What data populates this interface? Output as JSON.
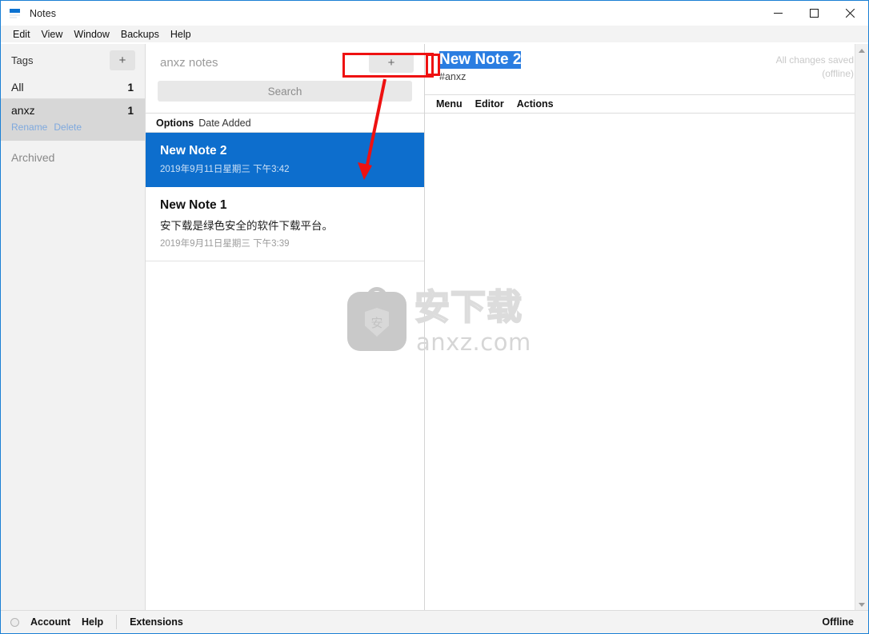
{
  "window": {
    "title": "Notes",
    "icon": "notes-app-icon",
    "controls": {
      "minimize": "minimize-icon",
      "maximize": "maximize-icon",
      "close": "close-icon"
    }
  },
  "menubar": {
    "items": [
      {
        "label": "Edit"
      },
      {
        "label": "View"
      },
      {
        "label": "Window"
      },
      {
        "label": "Backups"
      },
      {
        "label": "Help"
      }
    ]
  },
  "sidebar": {
    "header": {
      "title": "Tags",
      "add_label": "+"
    },
    "all": {
      "label": "All",
      "count": "1"
    },
    "tags": [
      {
        "label": "anxz",
        "count": "1",
        "selected": true,
        "actions": [
          "Rename",
          "Delete"
        ]
      }
    ],
    "archived": {
      "label": "Archived"
    }
  },
  "notelist": {
    "title": "anxz notes",
    "add_label": "+",
    "search": {
      "placeholder": "Search",
      "value": ""
    },
    "options": {
      "label": "Options",
      "sort": "Date Added"
    },
    "notes": [
      {
        "title": "New Note 2",
        "preview": "",
        "date": "2019年9月11日星期三 下午3:42",
        "selected": true
      },
      {
        "title": "New Note 1",
        "preview": "安下载是绿色安全的软件下载平台。",
        "date": "2019年9月11日星期三 下午3:39",
        "selected": false
      }
    ]
  },
  "editor": {
    "title": "New Note 2",
    "tags": "#anxz",
    "status_line1": "All changes saved",
    "status_line2": "(offline)",
    "toolbar": [
      {
        "label": "Menu"
      },
      {
        "label": "Editor"
      },
      {
        "label": "Actions"
      }
    ],
    "content": ""
  },
  "statusbar": {
    "account": "Account",
    "help": "Help",
    "extensions": "Extensions",
    "connection": "Offline"
  },
  "watermark": {
    "cn_text": "安下载",
    "url_text": "anxz.com",
    "badge_char": "安"
  },
  "colors": {
    "accent_blue": "#0d6ecd",
    "title_highlight": "#2a7de1",
    "annotation_red": "#ee1111",
    "sidebar_bg": "#f2f2f2",
    "selected_tag_bg": "#d7d7d7",
    "link_blue": "#7fa9de"
  }
}
